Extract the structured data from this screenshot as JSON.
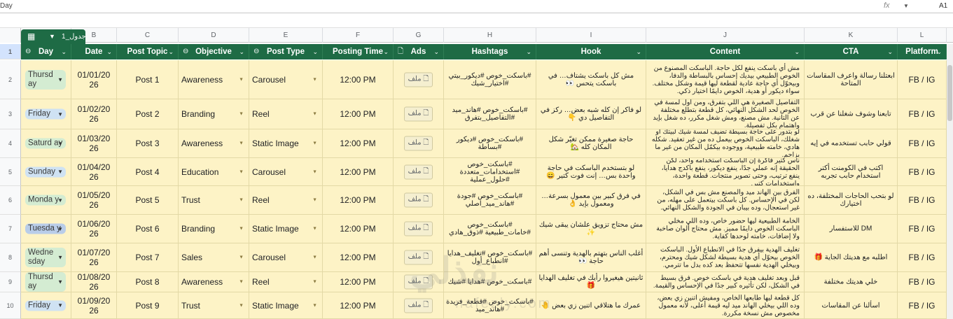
{
  "formula_bar": {
    "cell_content": "Day",
    "fx": "fx",
    "cell_ref": "A1"
  },
  "sheet_tab": {
    "label": "جدول_1",
    "icon": "table-icon"
  },
  "column_letters": [
    "A",
    "B",
    "C",
    "D",
    "E",
    "F",
    "G",
    "H",
    "I",
    "J",
    "K",
    "L"
  ],
  "headers": [
    "Day",
    "Date",
    "Post Topic",
    "Objective",
    "Post Type",
    "Posting Time",
    "Ads",
    "Hashtags",
    "Hook",
    "Content",
    "CTA",
    "Platform"
  ],
  "rows": [
    {
      "num": "2",
      "day": "Thursd ay",
      "day_color": "#d4ecd2",
      "date": "01/01/20 26",
      "topic": "Post 1",
      "objective": "Awareness",
      "type": "Carousel",
      "time": "12:00 PM",
      "ads": "ملف",
      "hashtags": "#باسكت_خوص #ديكور_بيتي #اختيار_شيك",
      "hook": "مش كل باسكت يشتاف… في باسكت يتحس 👀",
      "content": "مش أي باسكت ينفع لكل حاجة. الباسكت المصنوع من الخوص الطبيعي بيديك إحساس بالبساطة والدفا، وبيحوّل أي حاجة عادية لقطعة ليها قيمة وشكل مختلف. سواء ديكور أو هدية، الخوص دايمًا اختيار ذكي.",
      "cta": "ابعتلنا رسالة واعرف المقاسات المتاحة",
      "platform": "FB / IG"
    },
    {
      "num": "3",
      "day": "Friday",
      "day_color": "#cfe2f3",
      "date": "01/02/20 26",
      "topic": "Post 2",
      "objective": "Branding",
      "type": "Reel",
      "time": "12:00 PM",
      "ads": "ملف",
      "hashtags": "#باسكت_خوص #هاند_ميد #التفاصيل_بتفرق",
      "hook": "لو فاكر إن كله شبه بعض… ركز في التفاصيل دي 👇",
      "content": "التفاصيل الصغيرة هي اللي بتفرق، ومن أول لمسة في الخوص لحد الشكل النهائي، كل قطعة بتطلع مختلفة عن التانية. مش مصنع، ومش شغل مكرر، ده شغل بإيد واهتمام بكل تفصيلة.",
      "cta": "تابعنا وشوف شغلنا عن قرب",
      "platform": "FB / IG"
    },
    {
      "num": "4",
      "day": "Saturd ay",
      "day_color": "#d4ecd2",
      "date": "01/03/20 26",
      "topic": "Post 3",
      "objective": "Awareness",
      "type": "Static Image",
      "time": "12:00 PM",
      "ads": "ملف",
      "hashtags": "#باسكت_خوص #ديكور #بساطة",
      "hook": "حاجة صغيرة ممكن تغيّر شكل المكان كله 🏡",
      "content": "لو بتدور على حاجة بسيطة تضيف لمسة شيك لبيتك أو شغلك، الباسكت الخوص بيعمل ده من غير تعقيد. شكله هادي، خامته طبيعية، ووجوده بيكمّل المكان من غير ما يزاحم.",
      "cta": "قولي حابب تستخدمه في إيه",
      "platform": "FB / IG"
    },
    {
      "num": "5",
      "day": "Sunday",
      "day_color": "#cfe2f3",
      "date": "01/04/20 26",
      "topic": "Post 4",
      "objective": "Education",
      "type": "Carousel",
      "time": "12:00 PM",
      "ads": "ملف",
      "hashtags": "#باسكت_خوص #استخدامات_متعددة #حلول_عملية",
      "hook": "لو بتستخدم الباسكت في حاجة واحدة بس… إنت فوت كتير 😄",
      "content": "ناس كتير فاكرة إن الباسكت استخدامه واحد، لكن الحقيقة إنه عملي جدًا، ينفع ديكور، ينفع باكدج هدايا، ينفع ترتيب، وحتى تصوير منتجات. قطعة واحدة، واستخدامات كتير.",
      "cta": "اكتب في الكومنت أكتر استخدام حابب تجربه",
      "platform": "FB / IG"
    },
    {
      "num": "6",
      "day": "Monda y",
      "day_color": "#d4ecd2",
      "date": "01/05/20 26",
      "topic": "Post 5",
      "objective": "Trust",
      "type": "Reel",
      "time": "12:00 PM",
      "ads": "ملف",
      "hashtags": "#باسكت_خوص #جودة #هاند_ميد_اصلي",
      "hook": "في فرق كبير بين معمول بسرعة… ومعمول بإيد 👌",
      "content": "الفرق بين الهاند ميد والمصنع مش بس في الشكل، لكن في الإحساس. كل باسكت بيتعمل على مهله، من غير استعجال، وده بيبان في الجودة والشكل النهائي.",
      "cta": "لو بتحب الحاجات المختلفة، ده اختيارك",
      "platform": "FB / IG"
    },
    {
      "num": "7",
      "day": "Tuesda y",
      "day_color": "#b9cde9",
      "date": "01/06/20 26",
      "topic": "Post 6",
      "objective": "Branding",
      "type": "Static Image",
      "time": "12:00 PM",
      "ads": "ملف",
      "hashtags": "#باسكت_خوص #خامات_طبيعية #ذوق_هادي",
      "hook": "مش محتاج تزويق علشان يبقى شيك ✨",
      "content": "الخامة الطبيعية ليها حضور خاص، وده اللي مخلي الباسكت الخوص دايمًا مميز. مش محتاج ألوان صاخبة ولا إضافات، خامته لوحدها كفاية.",
      "cta": "DM للاستفسار",
      "platform": "FB / IG"
    },
    {
      "num": "8",
      "day": "Wedne sday",
      "day_color": "#d4ecd2",
      "date": "01/07/20 26",
      "topic": "Post 7",
      "objective": "Sales",
      "type": "Carousel",
      "time": "12:00 PM",
      "ads": "ملف",
      "hashtags": "#باسكت_خوص #تغليف_هدايا #انطباع_أول",
      "hook": "أغلب الناس بتهتم بالهدية وتنسى أهم حاجة 👀",
      "content": "تغليف الهدية بيفرق جدًا في الانطباع الأول. الباسكت الخوص بيحوّل أي هدية بسيطة لشكل شيك ومحترم، وبيخلي الهدية نفسها تتحفظ بعد كده بدل ما تترمي.",
      "cta": "اطلبه مع هديتك الجاية 🎁",
      "platform": "FB / IG"
    },
    {
      "num": "9",
      "day": "Thursd ay",
      "day_color": "#d4ecd2",
      "date": "01/08/20 26",
      "topic": "Post 8",
      "objective": "Awareness",
      "type": "Reel",
      "time": "12:00 PM",
      "ads": "ملف",
      "hashtags": "#باسكت_خوص #هدايا #شيك",
      "hook": "ثانيتين هيغيروا رأيك في تغليف الهدايا 🎁",
      "content": "قبل وبعد تغليف هدية في باسكت خوص. فرق بسيط في الشكل، لكن تأثيره كبير جدًا في الإحساس والقيمة.",
      "cta": "خلي هديتك مختلفة",
      "platform": "FB / IG"
    },
    {
      "num": "10",
      "day": "Friday",
      "day_color": "#cfe2f3",
      "date": "01/09/20 26",
      "topic": "Post 9",
      "objective": "Trust",
      "type": "Static Image",
      "time": "12:00 PM",
      "ads": "ملف",
      "hashtags": "#باسكت_خوص #قطعة_فريدة #هاند_ميد",
      "hook": "عمرك ما هتلاقي اتنين زي بعض 🤚",
      "content": "كل قطعة ليها طابعها الخاص، ومفيش اتنين زي بعض، وده اللي بيخلي الهاند ميد ليه قيمة أعلى، لأنه معمول مخصوص مش نسخة مكررة.",
      "cta": "اسألنا عن المقاسات",
      "platform": "FB / IG"
    }
  ],
  "watermark": {
    "text": "نفذلي",
    "sub": "nafezly.com"
  }
}
